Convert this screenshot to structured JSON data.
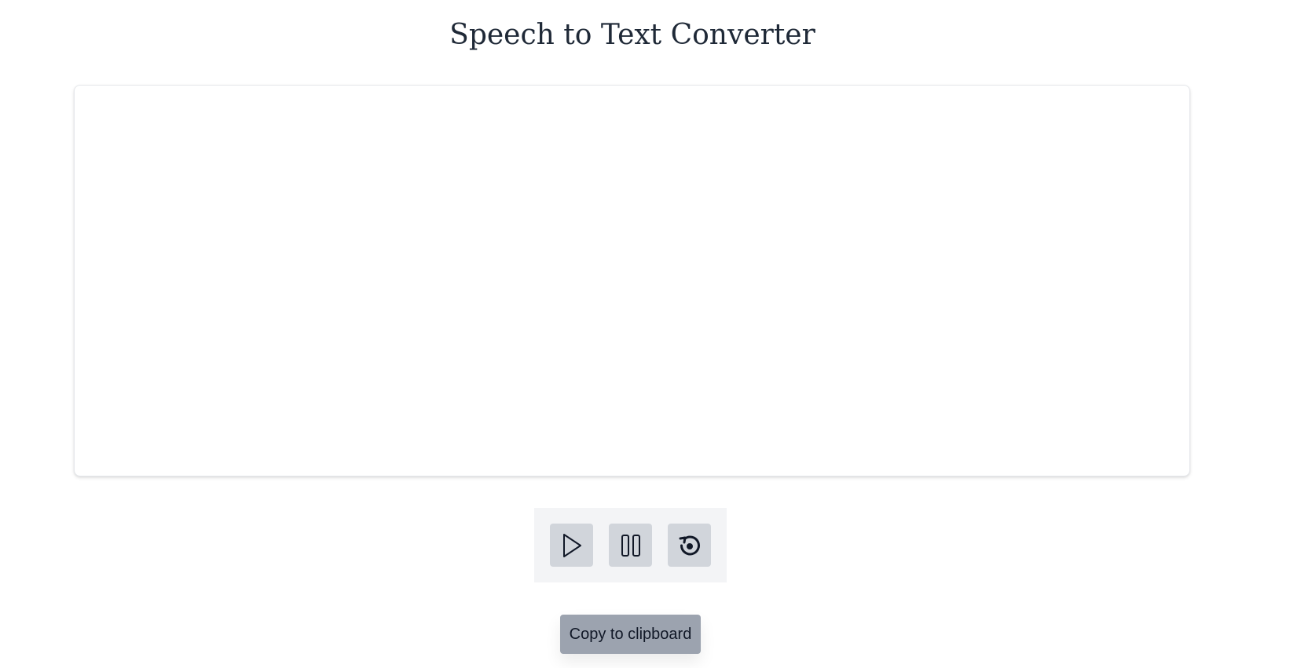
{
  "header": {
    "title": "Speech to Text Converter"
  },
  "transcript": {
    "value": "",
    "placeholder": ""
  },
  "controls": {
    "start_icon": "play-icon",
    "pause_icon": "pause-icon",
    "reset_icon": "reset-icon"
  },
  "actions": {
    "copy_label": "Copy to clipboard"
  },
  "colors": {
    "controls_bg": "#f3f4f6",
    "control_button_bg": "#d1d5db",
    "copy_button_bg": "#9ca3af",
    "text": "#1f2937"
  }
}
